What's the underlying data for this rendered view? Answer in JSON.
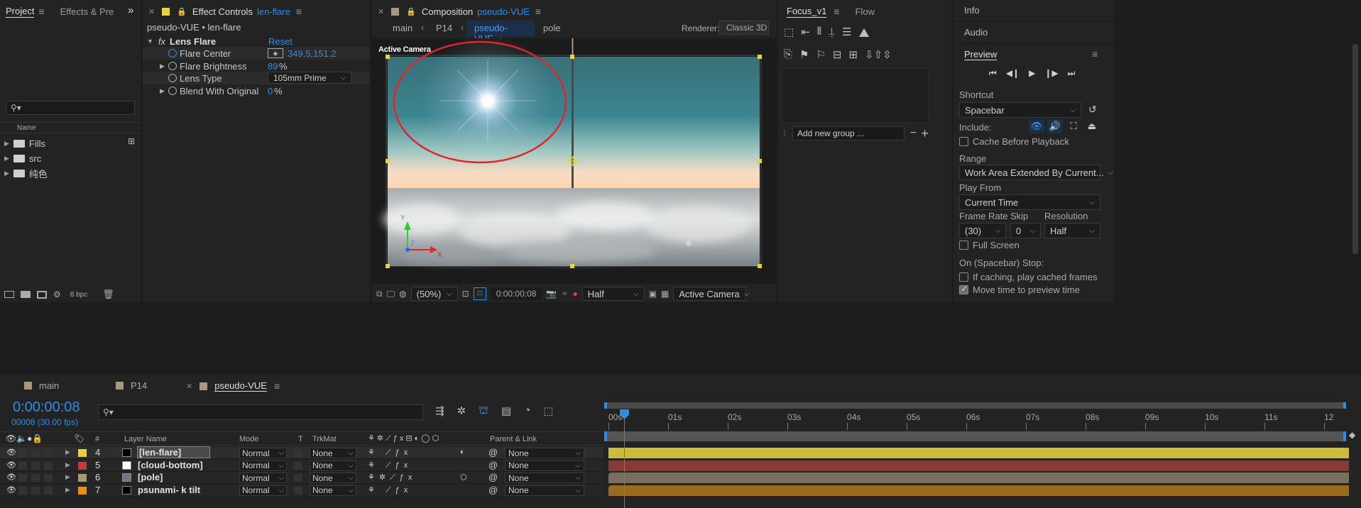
{
  "project": {
    "tabs": [
      "Project",
      "Effects & Pre"
    ],
    "overflow": "»",
    "search_placeholder": "",
    "column_name": "Name",
    "items": [
      {
        "name": "Fills"
      },
      {
        "name": "src"
      },
      {
        "name": "纯色"
      }
    ],
    "bpc": "8 bpc"
  },
  "effect_controls": {
    "tab_label": "Effect Controls",
    "tab_layer": "len-flare",
    "header": "pseudo-VUE • len-flare",
    "effect_name": "Lens Flare",
    "reset": "Reset",
    "fx": "fx",
    "props": [
      {
        "label": "Flare Center",
        "value_x": "349.5",
        "sep": ",",
        "value_y": "151.2"
      },
      {
        "label": "Flare Brightness",
        "value": "89",
        "unit": "%"
      },
      {
        "label": "Lens Type",
        "value": "105mm Prime"
      },
      {
        "label": "Blend With Original",
        "value": "0",
        "unit": "%"
      }
    ]
  },
  "composition": {
    "tab_label": "Composition",
    "tab_comp": "pseudo-VUE",
    "breadcrumbs": [
      "main",
      "P14",
      "pseudo-VUE",
      "pole"
    ],
    "renderer_label": "Renderer:",
    "renderer_value": "Classic 3D",
    "view_label": "Active Camera",
    "axis": {
      "x": "X",
      "y": "Y",
      "z": "Z"
    },
    "footer": {
      "zoom": "(50%)",
      "timecode": "0:00:00:08",
      "resolution": "Half",
      "camera": "Active Camera"
    }
  },
  "focus": {
    "tabs": [
      "Focus_v1",
      "Flow"
    ],
    "add_group_placeholder": "Add new group ..."
  },
  "right_panel": {
    "info": "Info",
    "audio": "Audio",
    "preview": "Preview",
    "shortcut_label": "Shortcut",
    "shortcut_value": "Spacebar",
    "include_label": "Include:",
    "cache_before": "Cache Before Playback",
    "range_label": "Range",
    "range_value": "Work Area Extended By Current...",
    "play_from_label": "Play From",
    "play_from_value": "Current Time",
    "frame_rate_label": "Frame Rate",
    "skip_label": "Skip",
    "resolution_label": "Resolution",
    "frame_rate_value": "(30)",
    "skip_value": "0",
    "resolution_value": "Half",
    "full_screen": "Full Screen",
    "on_stop": "On (Spacebar) Stop:",
    "if_caching": "If caching, play cached frames",
    "move_time": "Move time to preview time",
    "full_screen_checked": false,
    "cache_before_checked": false,
    "if_caching_checked": false,
    "move_time_checked": true
  },
  "timeline": {
    "tabs": [
      {
        "label": "main",
        "color": "#a79a7a"
      },
      {
        "label": "P14",
        "color": "#a79a7a"
      },
      {
        "label": "pseudo-VUE",
        "color": "#a79a7a"
      }
    ],
    "timecode": "0:00:00:08",
    "frames": "00008 (30.00 fps)",
    "columns": {
      "num": "#",
      "layer_name": "Layer Name",
      "mode": "Mode",
      "t": "T",
      "trkmat": "TrkMat",
      "parent": "Parent & Link"
    },
    "ruler": [
      "00s",
      "01s",
      "02s",
      "03s",
      "04s",
      "05s",
      "06s",
      "07s",
      "08s",
      "09s",
      "10s",
      "11s",
      "12"
    ],
    "layers": [
      {
        "num": "4",
        "label_color": "#e6d43a",
        "thumb": "#000000",
        "name": "[len-flare]",
        "mode": "Normal",
        "trkmat": "None",
        "parent": "None",
        "bar_color": "#cdbb3c",
        "selected": true
      },
      {
        "num": "5",
        "label_color": "#c83a3a",
        "thumb": "#ffffff",
        "name": "[cloud-bottom]",
        "mode": "Normal",
        "trkmat": "None",
        "parent": "None",
        "bar_color": "#8a3a34",
        "selected": false
      },
      {
        "num": "6",
        "label_color": "#a79a7a",
        "thumb": "#6a7a8a",
        "name": "[pole]",
        "mode": "Normal",
        "trkmat": "None",
        "parent": "None",
        "bar_color": "#7a6e60",
        "selected": false
      },
      {
        "num": "7",
        "label_color": "#e8901c",
        "thumb": "#000000",
        "name": "psunami- k tilt",
        "mode": "Normal",
        "trkmat": "None",
        "parent": "None",
        "bar_color": "#9a6a1e",
        "selected": false
      }
    ]
  },
  "colors": {
    "accent": "#2d8ceb",
    "annotation": "#e0262b",
    "handle": "#e6d43a"
  }
}
